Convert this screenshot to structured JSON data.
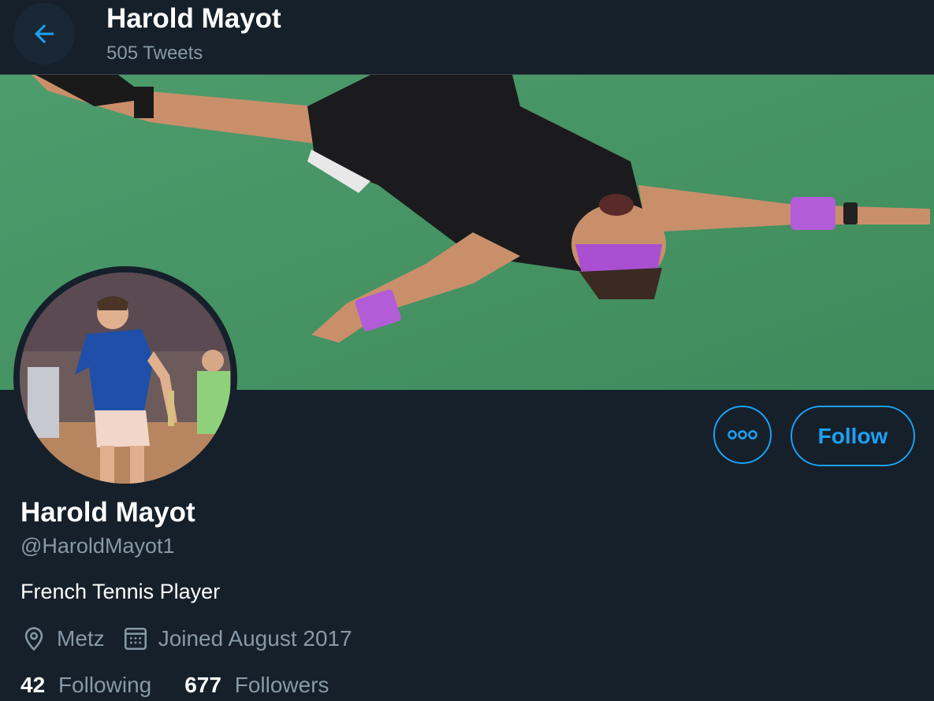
{
  "header": {
    "title": "Harold Mayot",
    "tweet_count": "505 Tweets",
    "back_icon": "arrow-left-icon"
  },
  "colors": {
    "background": "#15202b",
    "accent": "#1da1f2",
    "muted_text": "#8899a6",
    "divider": "#38444d"
  },
  "profile": {
    "name": "Harold Mayot",
    "handle": "@HaroldMayot1",
    "bio": "French Tennis Player",
    "location": "Metz",
    "location_icon": "location-pin-icon",
    "joined": "Joined August 2017",
    "joined_icon": "calendar-icon",
    "following_count": "42",
    "following_label": "Following",
    "followers_count": "677",
    "followers_label": "Followers"
  },
  "actions": {
    "more_icon": "more-options-icon",
    "follow_label": "Follow"
  },
  "media": {
    "banner": "banner-image",
    "avatar": "avatar-image"
  }
}
